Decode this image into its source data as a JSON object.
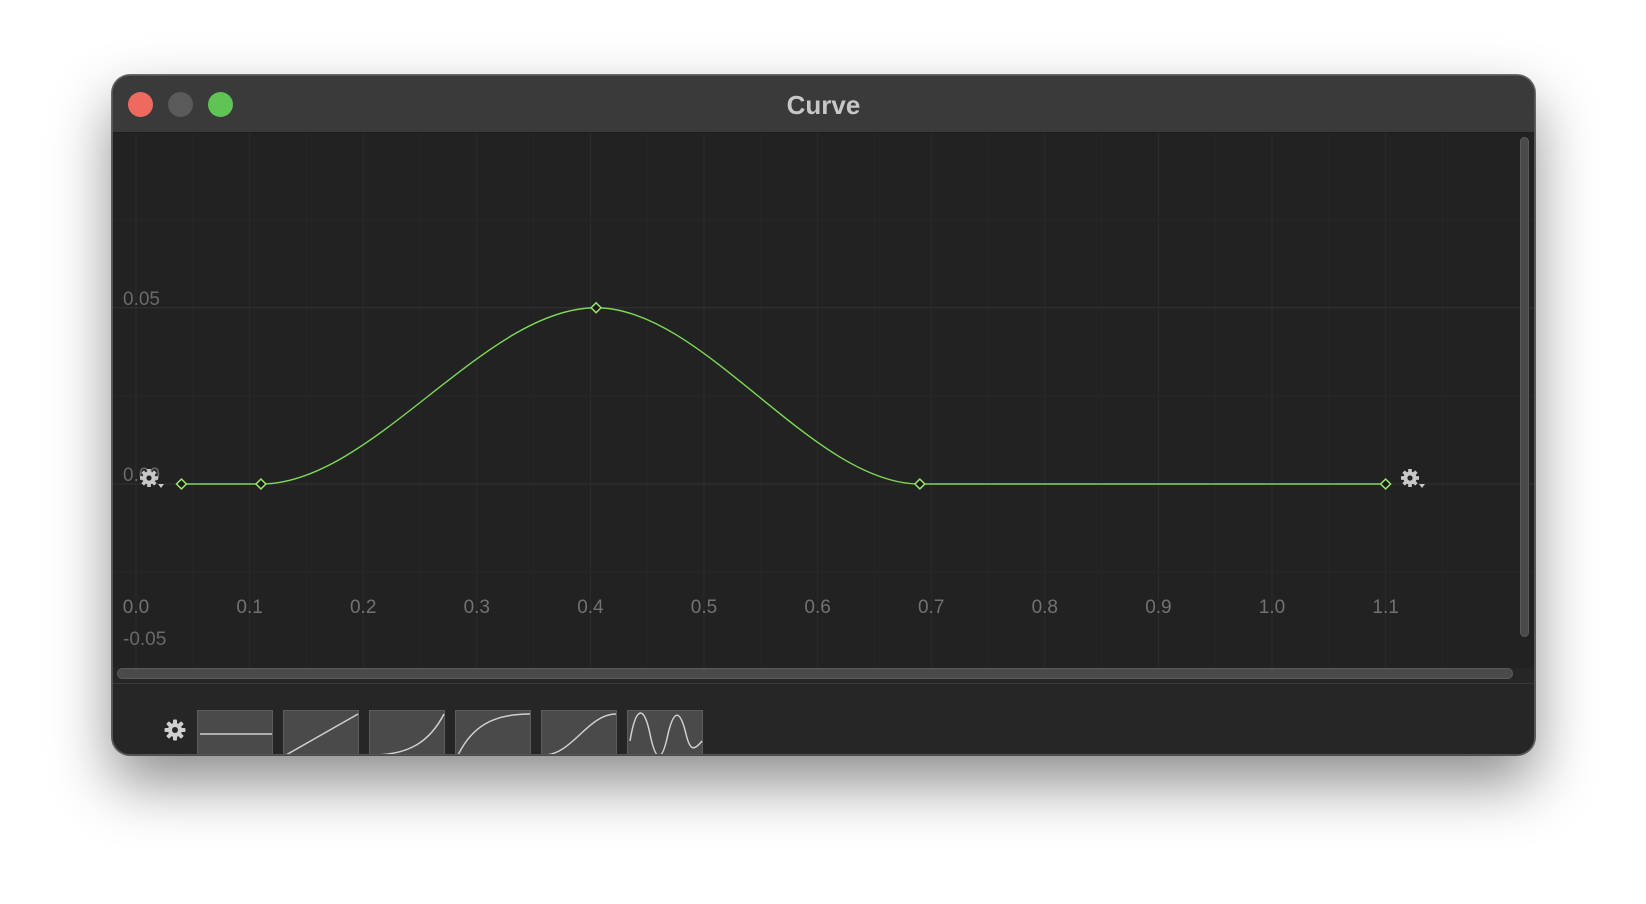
{
  "window": {
    "title": "Curve"
  },
  "chart_data": {
    "type": "line",
    "title": "",
    "xlabel": "",
    "ylabel": "",
    "xlim": [
      0.0,
      1.14
    ],
    "ylim": [
      -0.05,
      0.09
    ],
    "x_ticks": [
      "0.0",
      "0.1",
      "0.2",
      "0.3",
      "0.4",
      "0.5",
      "0.6",
      "0.7",
      "0.8",
      "0.9",
      "1.0",
      "1.1"
    ],
    "y_ticks": [
      "0.05",
      "0.00",
      "-0.05"
    ],
    "grid": true,
    "curve_color": "#7ed957",
    "keyframe_color": "#9be46c",
    "series": [
      {
        "points": [
          {
            "x": 0.04,
            "y": 0.0
          },
          {
            "x": 0.11,
            "y": 0.0
          },
          {
            "x": 0.405,
            "y": 0.05
          },
          {
            "x": 0.69,
            "y": 0.0
          },
          {
            "x": 1.1,
            "y": 0.0
          }
        ]
      }
    ]
  },
  "icons": {
    "left_gear": "gear-dropdown-icon",
    "right_gear": "gear-dropdown-icon",
    "preset_settings": "gear-icon"
  },
  "presets": [
    {
      "name": "flat-preset-icon"
    },
    {
      "name": "linear-preset-icon"
    },
    {
      "name": "ease-in-preset-icon"
    },
    {
      "name": "ease-out-preset-icon"
    },
    {
      "name": "ease-in-out-preset-icon"
    },
    {
      "name": "wave-preset-icon"
    }
  ],
  "colors": {
    "close": "#ee6a5f",
    "minimize": "#5a5a5a",
    "maximize": "#5fc454",
    "background": "#222222"
  }
}
